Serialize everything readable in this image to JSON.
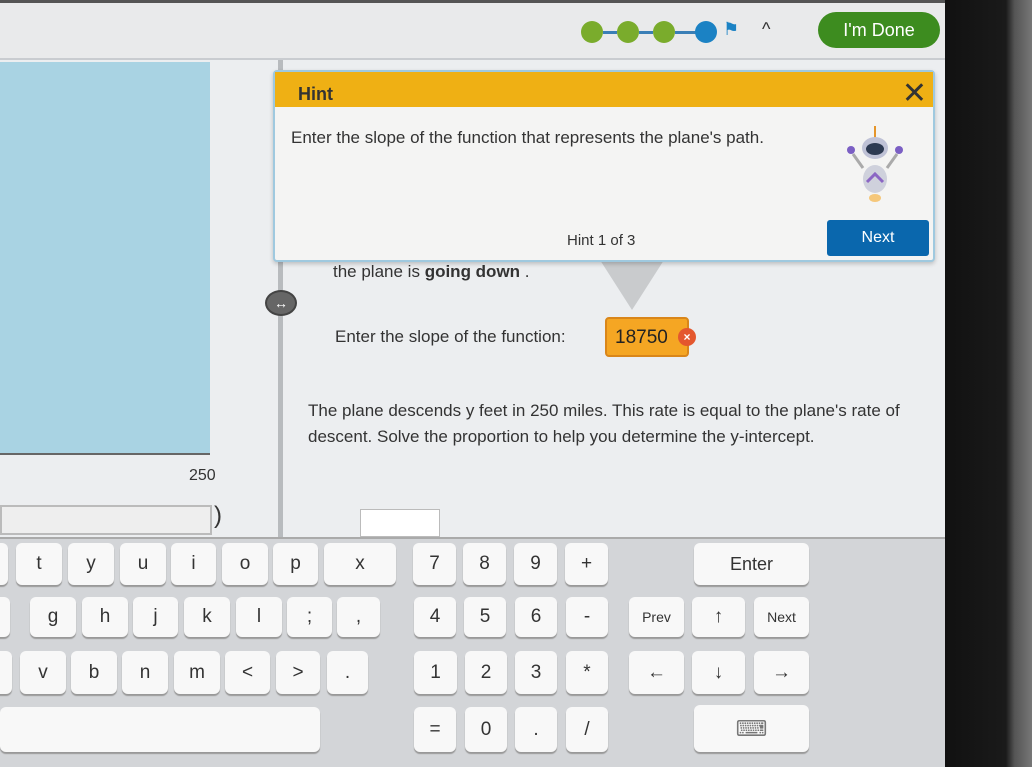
{
  "topbar": {
    "progress": {
      "completed": 3,
      "current": 4,
      "total": 4
    },
    "collapse_icon": "chevron-up",
    "done_label": "I'm Done"
  },
  "hint": {
    "title": "Hint",
    "text": "Enter the slope of the function that represents the plane's path.",
    "counter": "Hint 1 of 3",
    "next_label": "Next"
  },
  "left": {
    "axis_label": "250",
    "paren": ")"
  },
  "main": {
    "prev_text_prefix": "the plane is ",
    "prev_text_bold": "going down",
    "prev_text_suffix": " .",
    "slope_prompt": "Enter the slope of the function:",
    "slope_value": "18750",
    "problem_text": "The plane descends y feet in 250 miles. This rate is equal to the plane's rate of descent. Solve the proportion to help you determine the y-intercept."
  },
  "keyboard": {
    "rows": [
      [
        "t",
        "y",
        "u",
        "i",
        "o",
        "p",
        "x",
        "7",
        "8",
        "9",
        "+",
        "Enter"
      ],
      [
        "g",
        "h",
        "j",
        "k",
        "l",
        ";",
        ",",
        "4",
        "5",
        "6",
        "-",
        "Prev",
        "↑",
        "Next"
      ],
      [
        "v",
        "b",
        "n",
        "m",
        "<",
        ">",
        ".",
        "1",
        "2",
        "3",
        "*",
        "←",
        "↓",
        "→"
      ],
      [
        "=",
        "0",
        ".",
        "/"
      ]
    ]
  },
  "colors": {
    "accent_green": "#3d8c1f",
    "hint_orange": "#efb014",
    "next_blue": "#0a67ad",
    "answer_error": "#f5a623"
  }
}
